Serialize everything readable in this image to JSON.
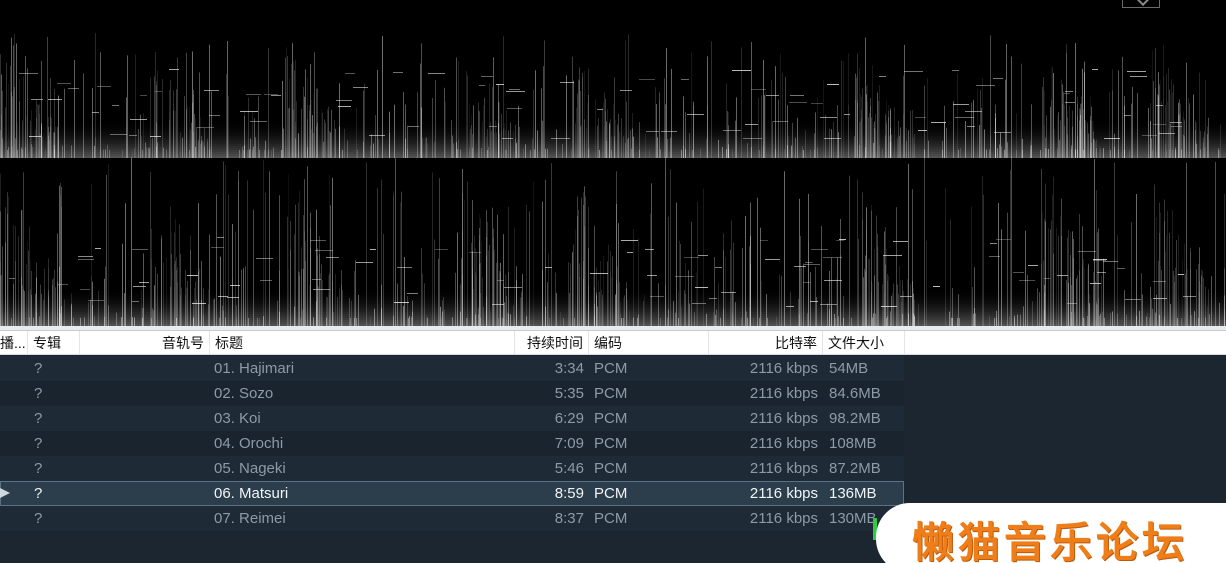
{
  "playlist": {
    "columns": {
      "now_playing": "播...",
      "album": "专辑",
      "track_no": "音轨号",
      "title": "标题",
      "duration": "持续时间",
      "codec": "编码",
      "bitrate": "比特率",
      "file_size": "文件大小"
    },
    "rows": [
      {
        "album": "?",
        "title": "01. Hajimari",
        "duration": "3:34",
        "codec": "PCM",
        "bitrate": "2116 kbps",
        "size": "54MB"
      },
      {
        "album": "?",
        "title": "02. Sozo",
        "duration": "5:35",
        "codec": "PCM",
        "bitrate": "2116 kbps",
        "size": "84.6MB"
      },
      {
        "album": "?",
        "title": "03. Koi",
        "duration": "6:29",
        "codec": "PCM",
        "bitrate": "2116 kbps",
        "size": "98.2MB"
      },
      {
        "album": "?",
        "title": "04. Orochi",
        "duration": "7:09",
        "codec": "PCM",
        "bitrate": "2116 kbps",
        "size": "108MB"
      },
      {
        "album": "?",
        "title": "05. Nageki",
        "duration": "5:46",
        "codec": "PCM",
        "bitrate": "2116 kbps",
        "size": "87.2MB"
      },
      {
        "album": "?",
        "title": "06. Matsuri",
        "duration": "8:59",
        "codec": "PCM",
        "bitrate": "2116 kbps",
        "size": "136MB"
      },
      {
        "album": "?",
        "title": "07. Reimei",
        "duration": "8:37",
        "codec": "PCM",
        "bitrate": "2116 kbps",
        "size": "130MB"
      }
    ],
    "playing_index": 5
  },
  "watermark": {
    "text": "懒猫音乐论坛"
  },
  "colors": {
    "accent_watermark": "#f07e18",
    "playlist_bg": "#1b2630",
    "playing_row": "#2c3e4c",
    "marker_green": "#2ecc40"
  },
  "icons": {
    "now_playing": "play-triangle-icon",
    "spectrogram_toggle": "chevron-down-icon"
  }
}
